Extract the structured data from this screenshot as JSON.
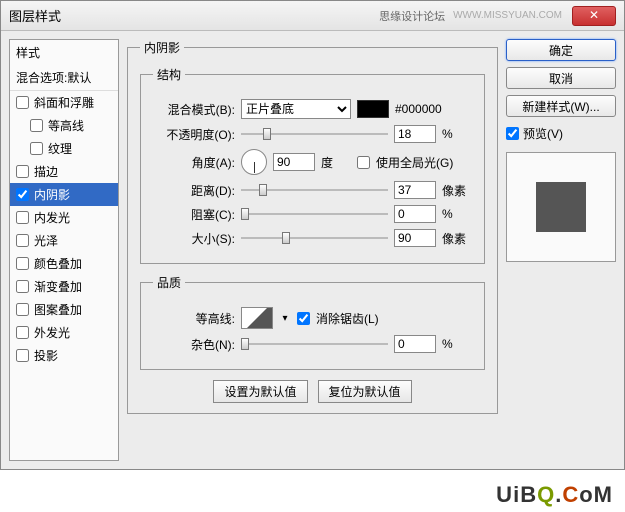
{
  "titlebar": {
    "title": "图层样式",
    "subtitle": "思缘设计论坛",
    "url": "WWW.MISSYUAN.COM"
  },
  "sidebar": {
    "header": "样式",
    "subheader": "混合选项:默认",
    "items": [
      {
        "label": "斜面和浮雕",
        "checked": false,
        "selected": false,
        "indent": false
      },
      {
        "label": "等高线",
        "checked": false,
        "selected": false,
        "indent": true
      },
      {
        "label": "纹理",
        "checked": false,
        "selected": false,
        "indent": true
      },
      {
        "label": "描边",
        "checked": false,
        "selected": false,
        "indent": false
      },
      {
        "label": "内阴影",
        "checked": true,
        "selected": true,
        "indent": false
      },
      {
        "label": "内发光",
        "checked": false,
        "selected": false,
        "indent": false
      },
      {
        "label": "光泽",
        "checked": false,
        "selected": false,
        "indent": false
      },
      {
        "label": "颜色叠加",
        "checked": false,
        "selected": false,
        "indent": false
      },
      {
        "label": "渐变叠加",
        "checked": false,
        "selected": false,
        "indent": false
      },
      {
        "label": "图案叠加",
        "checked": false,
        "selected": false,
        "indent": false
      },
      {
        "label": "外发光",
        "checked": false,
        "selected": false,
        "indent": false
      },
      {
        "label": "投影",
        "checked": false,
        "selected": false,
        "indent": false
      }
    ]
  },
  "panel": {
    "title": "内阴影",
    "structure": {
      "legend": "结构",
      "blendMode": {
        "label": "混合模式(B):",
        "value": "正片叠底",
        "color": "#000000",
        "hex": "#000000"
      },
      "opacity": {
        "label": "不透明度(O):",
        "value": "18",
        "unit": "%",
        "thumb": 15
      },
      "angle": {
        "label": "角度(A):",
        "value": "90",
        "unit": "度",
        "globalLight": {
          "label": "使用全局光(G)",
          "checked": false
        }
      },
      "distance": {
        "label": "距离(D):",
        "value": "37",
        "unit": "像素",
        "thumb": 12
      },
      "choke": {
        "label": "阻塞(C):",
        "value": "0",
        "unit": "%",
        "thumb": 0
      },
      "size": {
        "label": "大小(S):",
        "value": "90",
        "unit": "像素",
        "thumb": 28
      }
    },
    "quality": {
      "legend": "品质",
      "contour": {
        "label": "等高线:",
        "antiAlias": {
          "label": "消除锯齿(L)",
          "checked": true
        }
      },
      "noise": {
        "label": "杂色(N):",
        "value": "0",
        "unit": "%",
        "thumb": 0
      }
    },
    "defaults": {
      "set": "设置为默认值",
      "reset": "复位为默认值"
    }
  },
  "buttons": {
    "ok": "确定",
    "cancel": "取消",
    "newStyle": "新建样式(W)...",
    "preview": "预览(V)"
  },
  "watermark": "UiBQ.CoM"
}
